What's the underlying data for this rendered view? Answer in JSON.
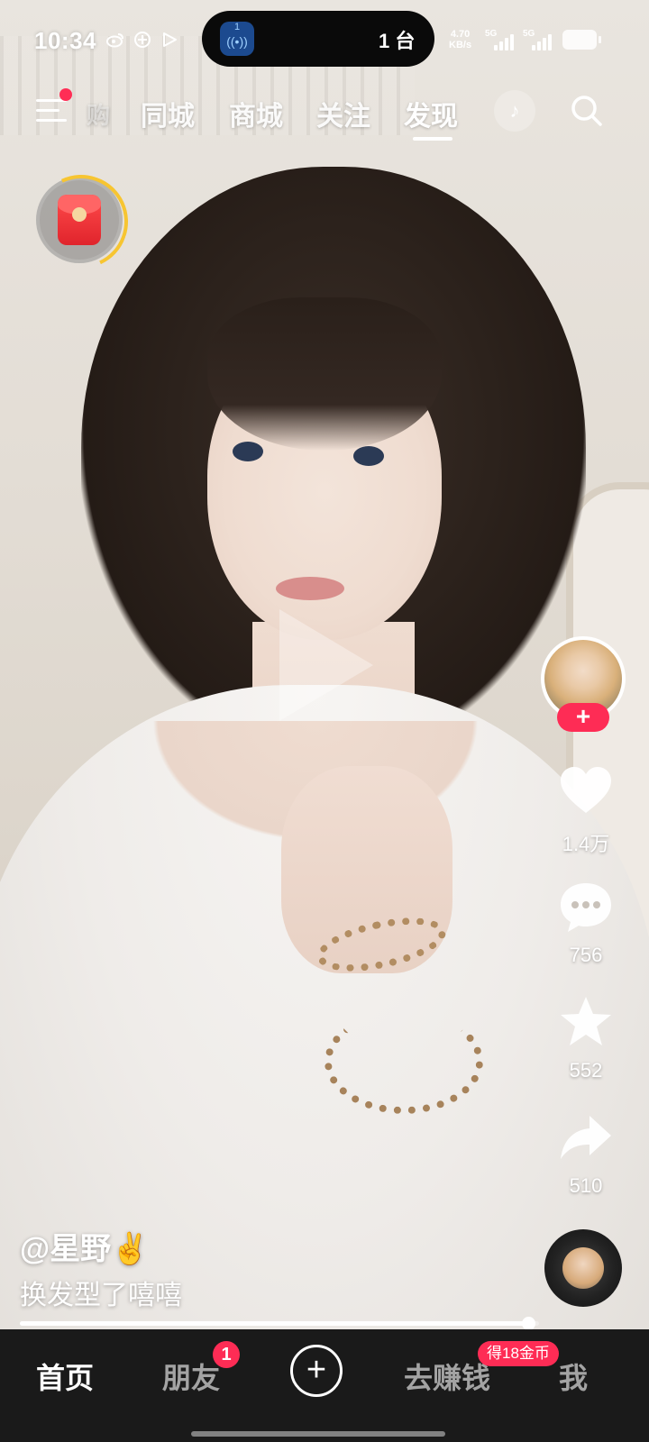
{
  "status_bar": {
    "time": "10:34",
    "island_app_label": "1",
    "island_text": "1 台",
    "net_speed_value": "4.70",
    "net_speed_unit": "KB/s",
    "signal1_label": "5G",
    "signal2_label": "5G",
    "icons": [
      "weibo-icon",
      "app-icon",
      "play-icon"
    ]
  },
  "top_nav": {
    "faded_tab": "购",
    "tabs": [
      "同城",
      "商城",
      "关注",
      "发现"
    ],
    "active_tab": "发现",
    "has_notification_dot": true
  },
  "video": {
    "author": "@星野✌️",
    "description": "换发型了嘻嘻",
    "progress": 0.98
  },
  "actions": {
    "likes": "1.4万",
    "comments": "756",
    "favorites": "552",
    "shares": "510",
    "follow_symbol": "+"
  },
  "bottom_nav": {
    "home": "首页",
    "friends": "朋友",
    "friends_badge": "1",
    "add_symbol": "+",
    "earn": "去赚钱",
    "earn_badge": "得18金币",
    "me": "我"
  },
  "colors": {
    "accent": "#fe2c55",
    "ring": "#f7c531",
    "tabbar_bg": "#1a1a1a"
  }
}
